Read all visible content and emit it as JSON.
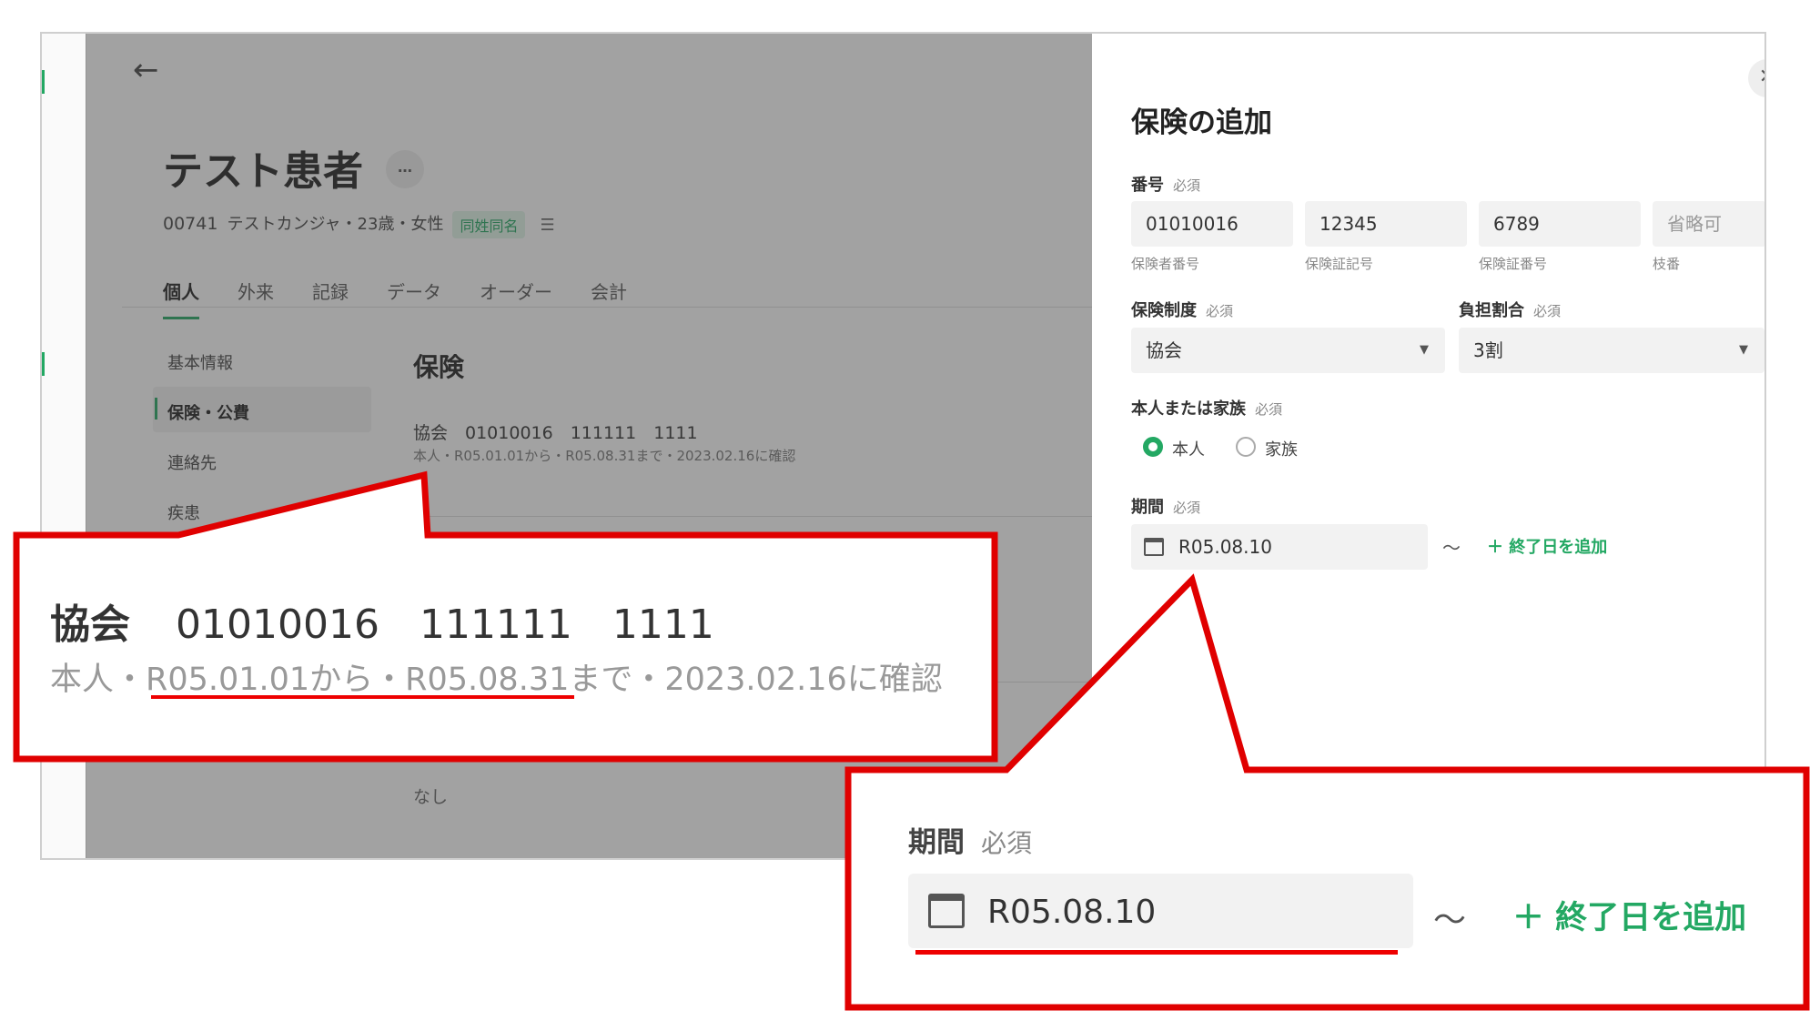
{
  "patient": {
    "name": "テスト患者",
    "more_label": "…",
    "id": "00741",
    "info": "テストカンジャ・23歳・女性",
    "tag": "同姓同名"
  },
  "tabs": [
    "個人",
    "外来",
    "記録",
    "データ",
    "オーダー",
    "会計"
  ],
  "sidebar": [
    "基本情報",
    "保険・公費",
    "連絡先",
    "疾患"
  ],
  "section": {
    "title": "保険",
    "insurance_line": "協会　01010016　111111　1111",
    "insurance_sub": "本人・R05.01.01から・R05.08.31まで・2023.02.16に確認",
    "none": "なし"
  },
  "modal": {
    "title": "保険の追加",
    "close": "✕",
    "required": "必須",
    "number": {
      "label": "番号",
      "fields": [
        {
          "value": "01010016",
          "caption": "保険者番号"
        },
        {
          "value": "12345",
          "caption": "保険証記号"
        },
        {
          "value": "6789",
          "caption": "保険証番号"
        },
        {
          "placeholder": "省略可",
          "caption": "枝番"
        }
      ]
    },
    "system": {
      "label": "保険制度",
      "value": "協会"
    },
    "ratio": {
      "label": "負担割合",
      "value": "3割"
    },
    "family": {
      "label": "本人または家族",
      "options": [
        "本人",
        "家族"
      ],
      "selected": "本人"
    },
    "period": {
      "label": "期間",
      "start": "R05.08.10",
      "tilde": "〜",
      "add_end": "＋ 終了日を追加"
    }
  },
  "callout1": {
    "kind": "協会",
    "numbers": "01010016　111111　1111",
    "sub": "本人・R05.01.01から・R05.08.31まで・2023.02.16に確認"
  },
  "callout2": {
    "label": "期間",
    "required": "必須",
    "date": "R05.08.10",
    "tilde": "〜",
    "add_end": "＋ 終了日を追加"
  },
  "colors": {
    "accent": "#23a863",
    "callout_border": "#e00000"
  }
}
